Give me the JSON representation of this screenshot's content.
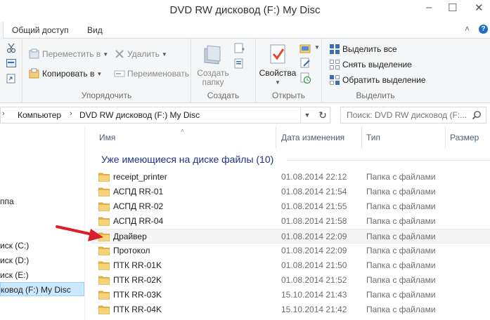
{
  "window": {
    "title": "DVD RW дисковод (F:) My Disc",
    "minimize": "–",
    "maximize": "☐",
    "close": "✕"
  },
  "ribbon_tabs": {
    "share": "Общий доступ",
    "view": "Вид",
    "collapse": "˄",
    "help": "?"
  },
  "ribbon": {
    "organize": {
      "label": "Упорядочить",
      "move_to": "Переместить в",
      "copy_to": "Копировать в",
      "delete": "Удалить",
      "rename": "Переименовать"
    },
    "create": {
      "label": "Создать",
      "new_folder": "Создать папку",
      "new_folder_l1": "Создать",
      "new_folder_l2": "папку"
    },
    "open": {
      "label": "Открыть",
      "properties": "Свойства"
    },
    "select": {
      "label": "Выделить",
      "select_all": "Выделить все",
      "select_none": "Снять выделение",
      "invert": "Обратить выделение"
    }
  },
  "address": {
    "crumbs": [
      "Компьютер",
      "DVD RW дисковод (F:) My Disc"
    ],
    "search_placeholder": "Поиск: DVD RW дисковод (F:..."
  },
  "nav": {
    "items": [
      {
        "label": "ппа",
        "selected": false
      },
      {
        "label": "иск (C:)",
        "selected": false
      },
      {
        "label": "иск (D:)",
        "selected": false
      },
      {
        "label": "иск (E:)",
        "selected": false
      },
      {
        "label": "ковод (F:) My Disc",
        "selected": true
      }
    ]
  },
  "columns": {
    "name": "Имя",
    "date": "Дата изменения",
    "type": "Тип",
    "size": "Размер"
  },
  "group": {
    "title": "Уже имеющиеся на диске файлы (10)"
  },
  "files": [
    {
      "name": "receipt_printer",
      "date": "01.08.2014 22:12",
      "type": "Папка с файлами"
    },
    {
      "name": "АСПД RR-01",
      "date": "01.08.2014 21:54",
      "type": "Папка с файлами"
    },
    {
      "name": "АСПД RR-02",
      "date": "01.08.2014 21:55",
      "type": "Папка с файлами"
    },
    {
      "name": "АСПД RR-04",
      "date": "01.08.2014 21:58",
      "type": "Папка с файлами"
    },
    {
      "name": "Драйвер",
      "date": "01.08.2014 22:09",
      "type": "Папка с файлами"
    },
    {
      "name": "Протокол",
      "date": "01.08.2014 22:09",
      "type": "Папка с файлами"
    },
    {
      "name": "ПТК RR-01K",
      "date": "01.08.2014 21:50",
      "type": "Папка с файлами"
    },
    {
      "name": "ПТК RR-02K",
      "date": "01.08.2014 21:52",
      "type": "Папка с файлами"
    },
    {
      "name": "ПТК RR-03K",
      "date": "15.10.2014 21:43",
      "type": "Папка с файлами"
    },
    {
      "name": "ПТК RR-04K",
      "date": "15.10.2014 21:42",
      "type": "Папка с файлами"
    }
  ],
  "colors": {
    "group_title": "#1e3287",
    "folder": "#f0c65a",
    "annotation_arrow": "#d9202a",
    "selection": "#cce8ff"
  }
}
